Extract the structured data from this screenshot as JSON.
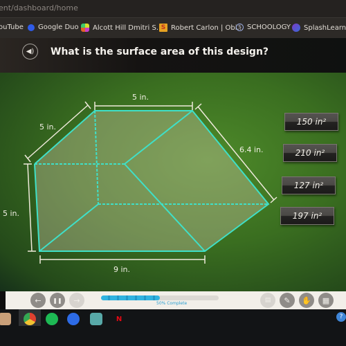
{
  "browser": {
    "url": "ent/dashboard/home",
    "bookmarks": [
      {
        "label": "ouTube",
        "icon": "youtube-icon",
        "color": "#e02a2a"
      },
      {
        "label": "Google Duo",
        "icon": "google-duo-icon",
        "color": "#2f5be8"
      },
      {
        "label": "Alcott Hill Dmitri S...",
        "icon": "alcott-hill-icon",
        "color": "#d4c02a"
      },
      {
        "label": "Robert Carlon | Obi...",
        "icon": "robert-carlon-icon",
        "color": "#e6a222"
      },
      {
        "label": "SCHOOLOGY",
        "icon": "schoology-icon",
        "color": "#4aa6c8"
      },
      {
        "label": "SplashLearn Sig",
        "icon": "splashlearn-icon",
        "color": "#7b3bc4"
      }
    ]
  },
  "question": {
    "text": "What is the surface area of this design?",
    "audio_icon": "speaker-icon"
  },
  "diagram": {
    "dimensions": {
      "top": "5 in.",
      "left_diagonal": "5 in.",
      "right_diagonal": "6.4 in.",
      "height": "5 in.",
      "bottom": "9 in."
    },
    "line_color": "#3fe0c8"
  },
  "answers": [
    {
      "label": "150 in²"
    },
    {
      "label": "210 in²"
    },
    {
      "label": "127 in²"
    },
    {
      "label": "197 in²"
    }
  ],
  "controls": {
    "back_icon": "←",
    "pause_icon": "❚❚",
    "forward_icon": "→",
    "progress_percent": 50,
    "progress_label": "50% Complete",
    "tools": [
      "notes-icon",
      "pencil-icon",
      "hand-icon",
      "calculator-icon"
    ]
  },
  "taskbar": {
    "apps": [
      "files-icon",
      "chrome-icon",
      "spotify-icon",
      "zoom-icon",
      "photo-app-icon",
      "netflix-icon"
    ],
    "help_label": "?"
  }
}
